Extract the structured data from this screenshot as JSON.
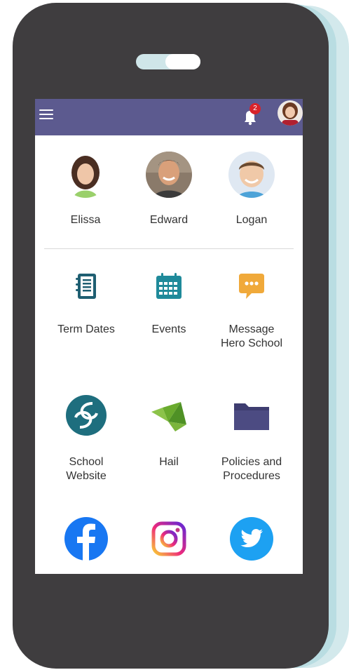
{
  "header": {
    "notification_count": "2"
  },
  "children": [
    {
      "name": "Elissa"
    },
    {
      "name": "Edward"
    },
    {
      "name": "Logan"
    }
  ],
  "tiles": [
    {
      "label": "Term Dates",
      "icon": "notebook-icon"
    },
    {
      "label": "Events",
      "icon": "calendar-icon"
    },
    {
      "label": "Message\nHero School",
      "icon": "chat-bubble-icon"
    },
    {
      "label": "School\nWebsite",
      "icon": "school-logo-icon"
    },
    {
      "label": "Hail",
      "icon": "hail-bird-icon"
    },
    {
      "label": "Policies and\nProcedures",
      "icon": "folder-icon"
    },
    {
      "label": "",
      "icon": "facebook-icon"
    },
    {
      "label": "",
      "icon": "instagram-icon"
    },
    {
      "label": "",
      "icon": "twitter-icon"
    }
  ],
  "colors": {
    "header_bg": "#5c5a8f",
    "teal": "#1f8a9a",
    "orange": "#f0a93a",
    "folder": "#4c4b82",
    "facebook": "#1877f2",
    "twitter": "#1da1f2"
  }
}
